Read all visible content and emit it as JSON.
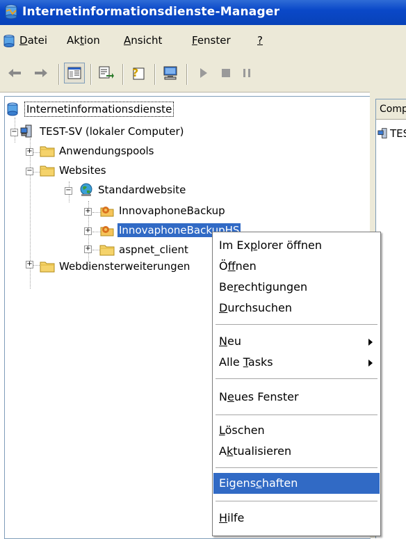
{
  "window": {
    "title": "Internetinformationsdienste-Manager"
  },
  "menubar": {
    "items": [
      {
        "label": "Datei",
        "mnemonic_html": "<u>D</u>atei"
      },
      {
        "label": "Aktion",
        "mnemonic_html": "Ak<u>t</u>ion"
      },
      {
        "label": "Ansicht",
        "mnemonic_html": "<u>A</u>nsicht"
      },
      {
        "label": "Fenster",
        "mnemonic_html": "<u>F</u>enster"
      },
      {
        "label": "?",
        "mnemonic_html": "<u>?</u>"
      }
    ]
  },
  "toolbar": {
    "buttons": [
      "back-icon",
      "forward-icon",
      "show-hide-tree-icon",
      "export-list-icon",
      "help-icon",
      "computer-icon",
      "play-icon",
      "stop-icon",
      "pause-icon"
    ]
  },
  "tree": {
    "root": "Internetinformationsdienste",
    "server": "TEST-SV (lokaler Computer)",
    "app_pools": "Anwendungspools",
    "websites": "Websites",
    "default_site": "Standardwebsite",
    "child1": "InnovaphoneBackup",
    "child2": "InnovaphoneBackupHS",
    "child3": "aspnet_client",
    "web_service_ext": "Webdiensterweiterungen"
  },
  "right_pane": {
    "column_header": "Computer",
    "row": "TEST-SV"
  },
  "context_menu": {
    "items": [
      {
        "label": "Im Explorer öffnen",
        "html": "Im Ex<u>p</u>lorer öffnen"
      },
      {
        "label": "Öffnen",
        "html": "Ö<u>f</u>fnen"
      },
      {
        "label": "Berechtigungen",
        "html": "Be<u>r</u>echtigungen"
      },
      {
        "label": "Durchsuchen",
        "html": "<u>D</u>urchsuchen"
      },
      {
        "label": "Neu",
        "html": "<u>N</u>eu"
      },
      {
        "label": "Alle Tasks",
        "html": "Alle <u>T</u>asks"
      },
      {
        "label": "Neues Fenster",
        "html": "N<u>e</u>ues Fenster"
      },
      {
        "label": "Löschen",
        "html": "<u>L</u>öschen"
      },
      {
        "label": "Aktualisieren",
        "html": "A<u>k</u>tualisieren"
      },
      {
        "label": "Eigenschaften",
        "html": "Eigens<u>c</u>haften"
      },
      {
        "label": "Hilfe",
        "html": "<u>H</u>ilfe"
      }
    ]
  },
  "colors": {
    "selection": "#316ac5",
    "titlebar": "#0a48c8",
    "chrome": "#ece9d8"
  }
}
